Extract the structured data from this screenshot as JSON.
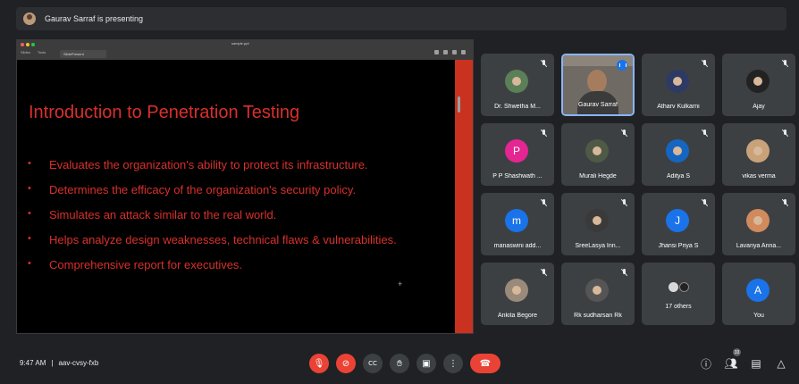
{
  "header": {
    "presenter_text": "Gaurav Sarraf is presenting"
  },
  "screen": {
    "file_name": "sample.ppt",
    "menu": [
      "Slides",
      "Tools"
    ],
    "tab_label": "SlidePresent",
    "slide": {
      "title": "Introduction to Penetration Testing",
      "bullets": [
        "Evaluates the organization's ability to protect its infrastructure.",
        "Determines the efficacy of the organization's security policy.",
        "Simulates an attack similar to the real world.",
        "Helps analyze design weaknesses, technical flaws & vulnerabilities.",
        "Comprehensive report for executives."
      ],
      "bullet_char": "•"
    }
  },
  "participants": [
    {
      "name": "Dr. Shwetha M...",
      "avatar": "photo",
      "mic": "muted"
    },
    {
      "name": "Gaurav Sarraf",
      "avatar": "video",
      "mic": "speaking"
    },
    {
      "name": "Atharv Kulkarni",
      "avatar": "photo",
      "mic": "muted"
    },
    {
      "name": "Ajay",
      "avatar": "photo",
      "mic": "muted"
    },
    {
      "name": "P P Shashwath ...",
      "avatar": "letter",
      "letter": "P",
      "color": "#e52592",
      "mic": "muted"
    },
    {
      "name": "Murali Hegde",
      "avatar": "photo",
      "mic": "muted"
    },
    {
      "name": "Aditya S",
      "avatar": "photo",
      "mic": "muted"
    },
    {
      "name": "vikas verma",
      "avatar": "photo",
      "mic": "muted"
    },
    {
      "name": "manaswini add...",
      "avatar": "letter",
      "letter": "m",
      "color": "#1a73e8",
      "mic": "muted"
    },
    {
      "name": "SreeLasya Inn...",
      "avatar": "photo",
      "mic": "muted"
    },
    {
      "name": "Jhansi Priya S",
      "avatar": "letter",
      "letter": "J",
      "color": "#1a73e8",
      "mic": "muted"
    },
    {
      "name": "Lavanya Anna...",
      "avatar": "photo",
      "mic": "muted"
    },
    {
      "name": "Ankita Begore",
      "avatar": "photo",
      "mic": "muted"
    },
    {
      "name": "Rk sudharsan Rk",
      "avatar": "photo",
      "mic": "muted"
    },
    {
      "name": "17 others",
      "avatar": "group",
      "mic": "none"
    },
    {
      "name": "You",
      "avatar": "letter",
      "letter": "A",
      "color": "#1a73e8",
      "mic": "none"
    }
  ],
  "bottom": {
    "time": "9:47 AM",
    "separator": "|",
    "meeting_code": "aav-cvsy-fxb",
    "people_count": "33"
  },
  "icons": {
    "mic": "mic-off-icon",
    "camera": "camera-off-icon",
    "captions": "captions-icon",
    "hand": "raise-hand-icon",
    "present": "present-icon",
    "more": "more-options-icon",
    "end": "end-call-icon",
    "info": "info-icon",
    "people": "people-icon",
    "chat": "chat-icon",
    "activities": "activities-icon"
  },
  "colors": {
    "background": "#202124",
    "tile": "#3c4043",
    "slide_text": "#d9302b",
    "active_border": "#8ab4f8",
    "end_call": "#ea4335"
  }
}
